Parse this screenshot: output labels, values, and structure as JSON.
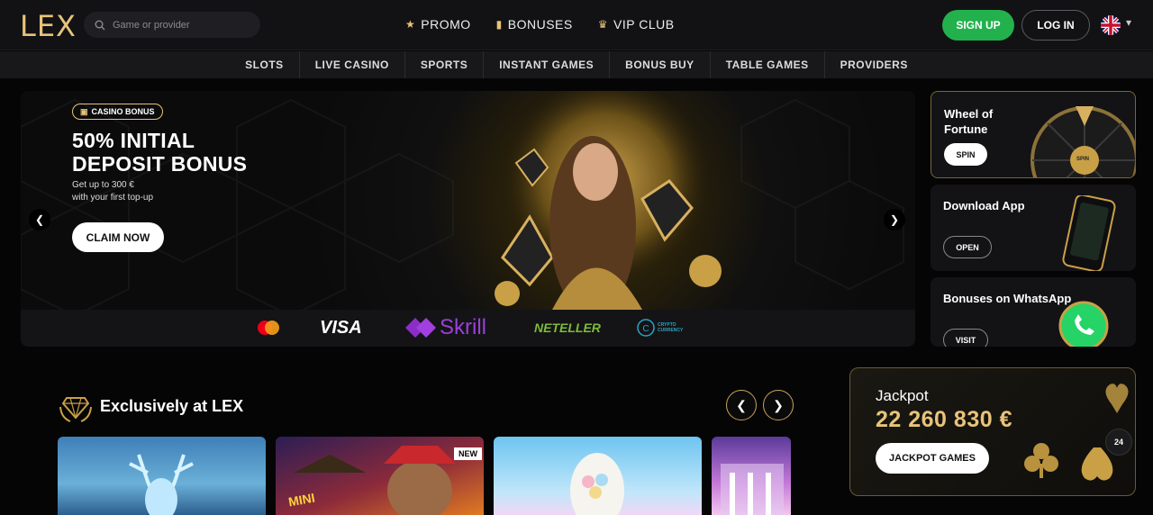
{
  "header": {
    "logo": "LEX",
    "search_placeholder": "Game or provider",
    "nav": [
      {
        "label": "PROMO",
        "icon": "star-icon"
      },
      {
        "label": "BONUSES",
        "icon": "gift-icon"
      },
      {
        "label": "VIP CLUB",
        "icon": "crown-icon"
      }
    ],
    "signup": "SIGN UP",
    "login": "LOG IN",
    "language_icon": "uk-flag-icon"
  },
  "categories": [
    "SLOTS",
    "LIVE CASINO",
    "SPORTS",
    "INSTANT GAMES",
    "BONUS BUY",
    "TABLE GAMES",
    "PROVIDERS"
  ],
  "hero": {
    "badge": "CASINO BONUS",
    "title_line1": "50% INITIAL",
    "title_line2": "DEPOSIT BONUS",
    "sub_line1": "Get up to 300 €",
    "sub_line2": "with your first top-up",
    "cta": "CLAIM NOW",
    "payments": {
      "visa": "VISA",
      "skrill": "Skrill",
      "neteller": "NETELLER",
      "crypto1": "CRYPTO",
      "crypto2": "CURRENCY"
    }
  },
  "side_cards": [
    {
      "title_line1": "Wheel of",
      "title_line2": "Fortune",
      "button": "SPIN",
      "wheel_label": "SPIN"
    },
    {
      "title_line1": "Download App",
      "title_line2": "",
      "button": "OPEN"
    },
    {
      "title_line1": "Bonuses on WhatsApp",
      "title_line2": "",
      "button": "VISIT"
    }
  ],
  "exclusive": {
    "title": "Exclusively at LEX",
    "tiles": [
      {
        "badge": ""
      },
      {
        "badge": "NEW",
        "caption": "MINI"
      },
      {
        "badge": ""
      },
      {
        "badge": ""
      }
    ]
  },
  "jackpot": {
    "label": "Jackpot",
    "value": "22 260 830 €",
    "button": "JACKPOT GAMES"
  },
  "support": {
    "label": "24"
  },
  "colors": {
    "accent_gold": "#e8c37a",
    "signup_green": "#22b14c",
    "background": "#050506"
  }
}
